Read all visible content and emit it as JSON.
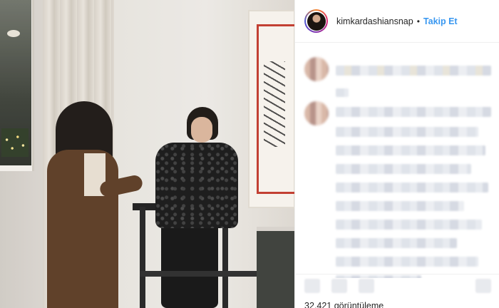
{
  "post": {
    "username": "kimkardashiansnap",
    "separator": "•",
    "follow_label": "Takip Et",
    "view_count": "32.421 görüntüleme"
  },
  "icons": {
    "header": [
      "avatar-icon"
    ],
    "footer": [
      "like-icon",
      "comment-icon",
      "share-icon",
      "bookmark-icon"
    ]
  },
  "colors": {
    "follow_blue": "#3897f0",
    "text": "#262626",
    "divider": "#efefef"
  }
}
